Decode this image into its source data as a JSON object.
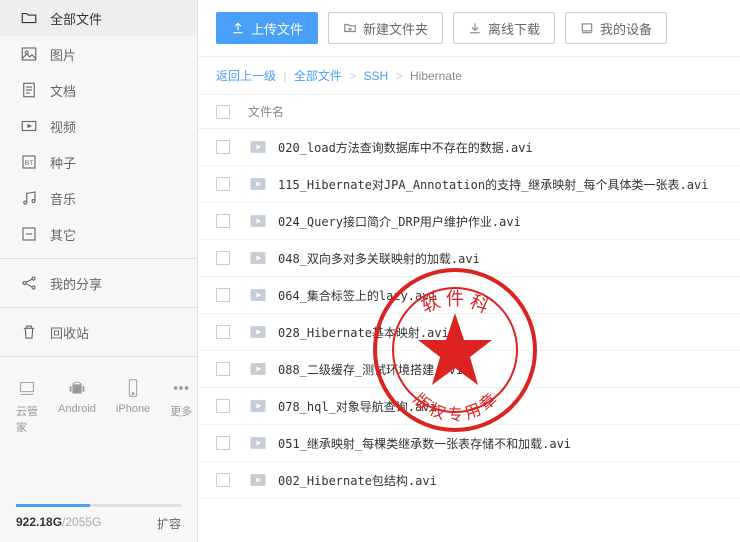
{
  "sidebar": {
    "items": [
      {
        "label": "全部文件",
        "icon": "folder"
      },
      {
        "label": "图片",
        "icon": "image"
      },
      {
        "label": "文档",
        "icon": "document"
      },
      {
        "label": "视频",
        "icon": "video"
      },
      {
        "label": "种子",
        "icon": "bt"
      },
      {
        "label": "音乐",
        "icon": "music"
      },
      {
        "label": "其它",
        "icon": "other"
      }
    ],
    "share": "我的分享",
    "trash": "回收站",
    "platforms": [
      {
        "label": "云管家",
        "icon": "cloud"
      },
      {
        "label": "Android",
        "icon": "android"
      },
      {
        "label": "iPhone",
        "icon": "iphone"
      },
      {
        "label": "更多",
        "icon": "more"
      }
    ],
    "storage_used": "922.18G",
    "storage_total": "/2055G",
    "expand": "扩容"
  },
  "toolbar": {
    "upload": "上传文件",
    "newfolder": "新建文件夹",
    "offline": "离线下载",
    "device": "我的设备"
  },
  "breadcrumb": {
    "back": "返回上一级",
    "all": "全部文件",
    "ssh": "SSH",
    "current": "Hibernate"
  },
  "filehead": {
    "name": "文件名"
  },
  "files": [
    {
      "name": "020_load方法查询数据库中不存在的数据.avi"
    },
    {
      "name": "115_Hibernate对JPA_Annotation的支持_继承映射_每个具体类一张表.avi"
    },
    {
      "name": "024_Query接口简介_DRP用户维护作业.avi"
    },
    {
      "name": "048_双向多对多关联映射的加载.avi"
    },
    {
      "name": "064_集合标签上的lazy.avi"
    },
    {
      "name": "028_Hibernate基本映射.avi"
    },
    {
      "name": "088_二级缓存_测试环境搭建.avi"
    },
    {
      "name": "078_hql_对象导航查询.avi"
    },
    {
      "name": "051_继承映射_每棵类继承数一张表存储不和加载.avi"
    },
    {
      "name": "002_Hibernate包结构.avi"
    }
  ],
  "stamp": {
    "outer": "版权专用章",
    "inner": "软件科"
  }
}
